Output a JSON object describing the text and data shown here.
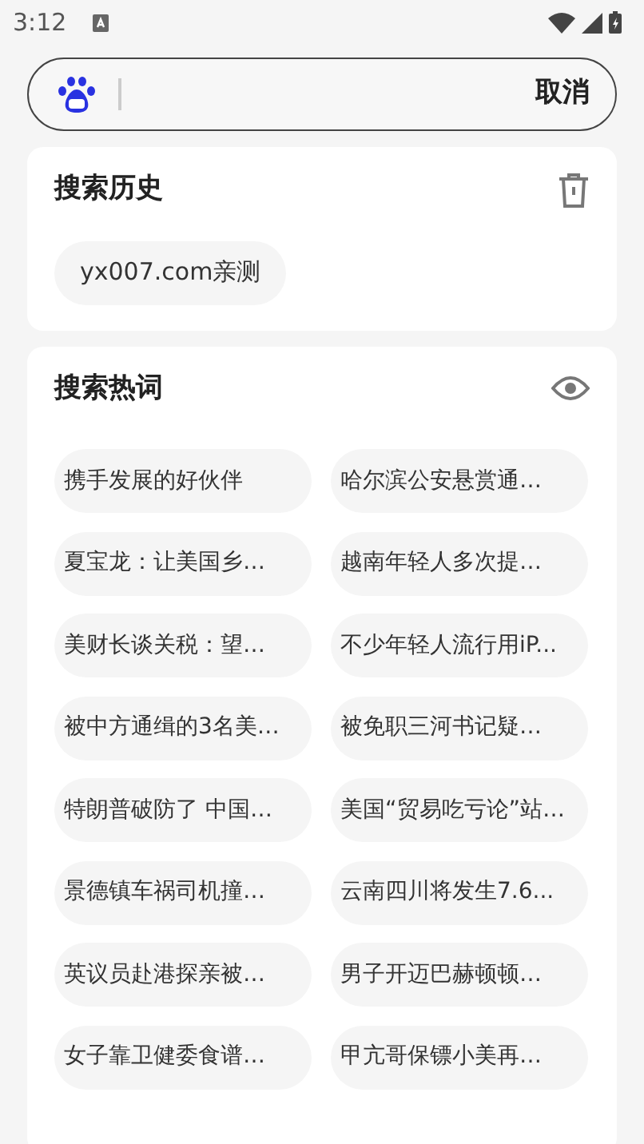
{
  "status_bar": {
    "time": "3:12"
  },
  "search": {
    "cancel": "取消"
  },
  "history": {
    "title": "搜索历史",
    "items": [
      "yx007.com亲测"
    ]
  },
  "hot": {
    "title": "搜索热词",
    "items": [
      "携手发展的好伙伴",
      "哈尔滨公安悬赏通…",
      "夏宝龙：让美国乡…",
      "越南年轻人多次提…",
      "美财长谈关税：望…",
      "不少年轻人流行用iP...",
      "被中方通缉的3名美…",
      "被免职三河书记疑…",
      "特朗普破防了 中国…",
      "美国“贸易吃亏论”站…",
      "景德镇车祸司机撞…",
      "云南四川将发生7.6...",
      "英议员赴港探亲被…",
      "男子开迈巴赫顿顿…",
      "女子靠卫健委食谱…",
      "甲亢哥保镖小美再…"
    ]
  }
}
